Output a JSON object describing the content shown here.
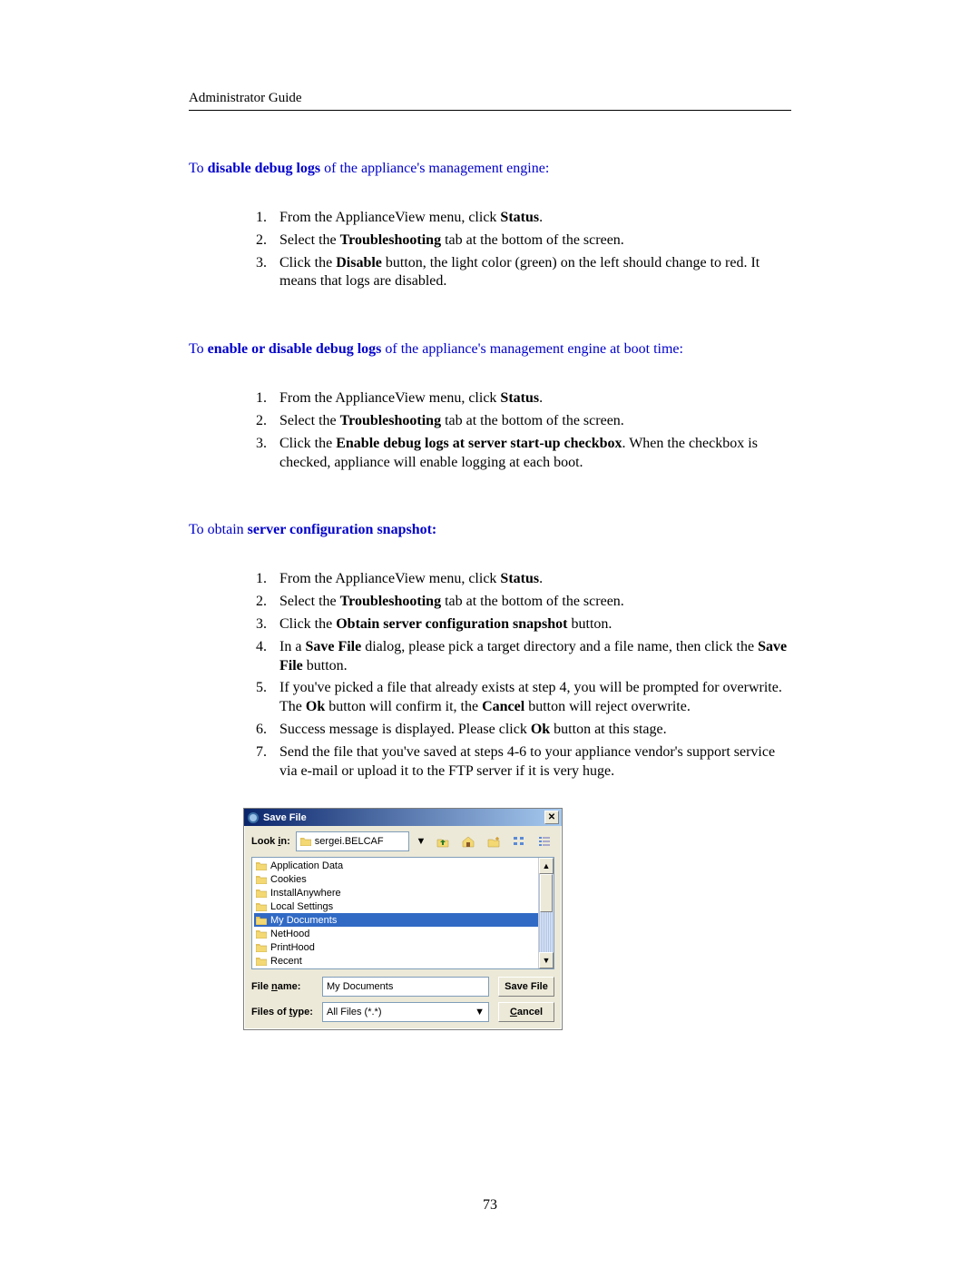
{
  "header": "Administrator Guide",
  "page_number": "73",
  "section1": {
    "heading_prefix": "To ",
    "heading_bold": "disable debug logs",
    "heading_suffix": " of the appliance's management engine:",
    "items": [
      {
        "pre": "From the ApplianceView menu, click ",
        "b1": "Status",
        "post": "."
      },
      {
        "pre": "Select the ",
        "b1": "Troubleshooting",
        "post": " tab at the bottom of the screen."
      },
      {
        "pre": "Click the ",
        "b1": "Disable",
        "post": " button, the light color (green) on the left should change to red. It means that logs are disabled."
      }
    ]
  },
  "section2": {
    "heading_prefix": "To ",
    "heading_bold": "enable or disable debug logs",
    "heading_suffix": " of the appliance's management engine at boot time:",
    "items": [
      {
        "pre": "From the ApplianceView menu, click ",
        "b1": "Status",
        "post": "."
      },
      {
        "pre": "Select the ",
        "b1": "Troubleshooting",
        "post": " tab at the bottom of the screen."
      },
      {
        "pre": "Click the ",
        "b1": "Enable debug logs at server start-up checkbox",
        "post": ". When the checkbox is checked, appliance will enable logging at each boot."
      }
    ]
  },
  "section3": {
    "heading_prefix": "To obtain ",
    "heading_bold": "server configuration snapshot:",
    "heading_suffix": "",
    "items": [
      {
        "pre": "From the ApplianceView menu, click ",
        "b1": "Status",
        "post": "."
      },
      {
        "pre": "Select the ",
        "b1": "Troubleshooting",
        "post": " tab at the bottom of the screen."
      },
      {
        "pre": "Click the ",
        "b1": "Obtain server configuration snapshot",
        "post": " button."
      },
      {
        "pre": "In a ",
        "b1": "Save File",
        "mid": " dialog, please pick a target directory and a file name, then click the ",
        "b2": "Save File",
        "post": " button."
      },
      {
        "pre": "If you've picked a file that already exists at step 4, you will be prompted for overwrite. The ",
        "b1": "Ok",
        "mid": " button will confirm it, the ",
        "b2": "Cancel",
        "post": " button will reject overwrite."
      },
      {
        "pre": "Success message is displayed. Please click ",
        "b1": "Ok",
        "post": " button at this stage."
      },
      {
        "pre": "Send the file that you've saved at steps 4-6 to your appliance vendor's support service via e-mail or upload it to the FTP server if it is very huge.",
        "b1": "",
        "post": ""
      }
    ]
  },
  "dialog": {
    "title": "Save File",
    "look_in_label_first": "i",
    "look_in_label": "Look ",
    "look_in_label_last": "n:",
    "look_in_value": "sergei.BELCAF",
    "files": [
      {
        "name": "Application Data",
        "selected": false
      },
      {
        "name": "Cookies",
        "selected": false
      },
      {
        "name": "InstallAnywhere",
        "selected": false
      },
      {
        "name": "Local Settings",
        "selected": false
      },
      {
        "name": "My Documents",
        "selected": true
      },
      {
        "name": "NetHood",
        "selected": false
      },
      {
        "name": "PrintHood",
        "selected": false
      },
      {
        "name": "Recent",
        "selected": false
      }
    ],
    "file_name_label_pre": "File ",
    "file_name_label_ul": "n",
    "file_name_label_post": "ame:",
    "file_name_value": "My Documents",
    "files_of_type_label_pre": "Files of ",
    "files_of_type_label_ul": "t",
    "files_of_type_label_post": "ype:",
    "files_of_type_value": "All Files (*.*)",
    "save_button": "Save File",
    "cancel_button_ul": "C",
    "cancel_button_rest": "ancel"
  }
}
